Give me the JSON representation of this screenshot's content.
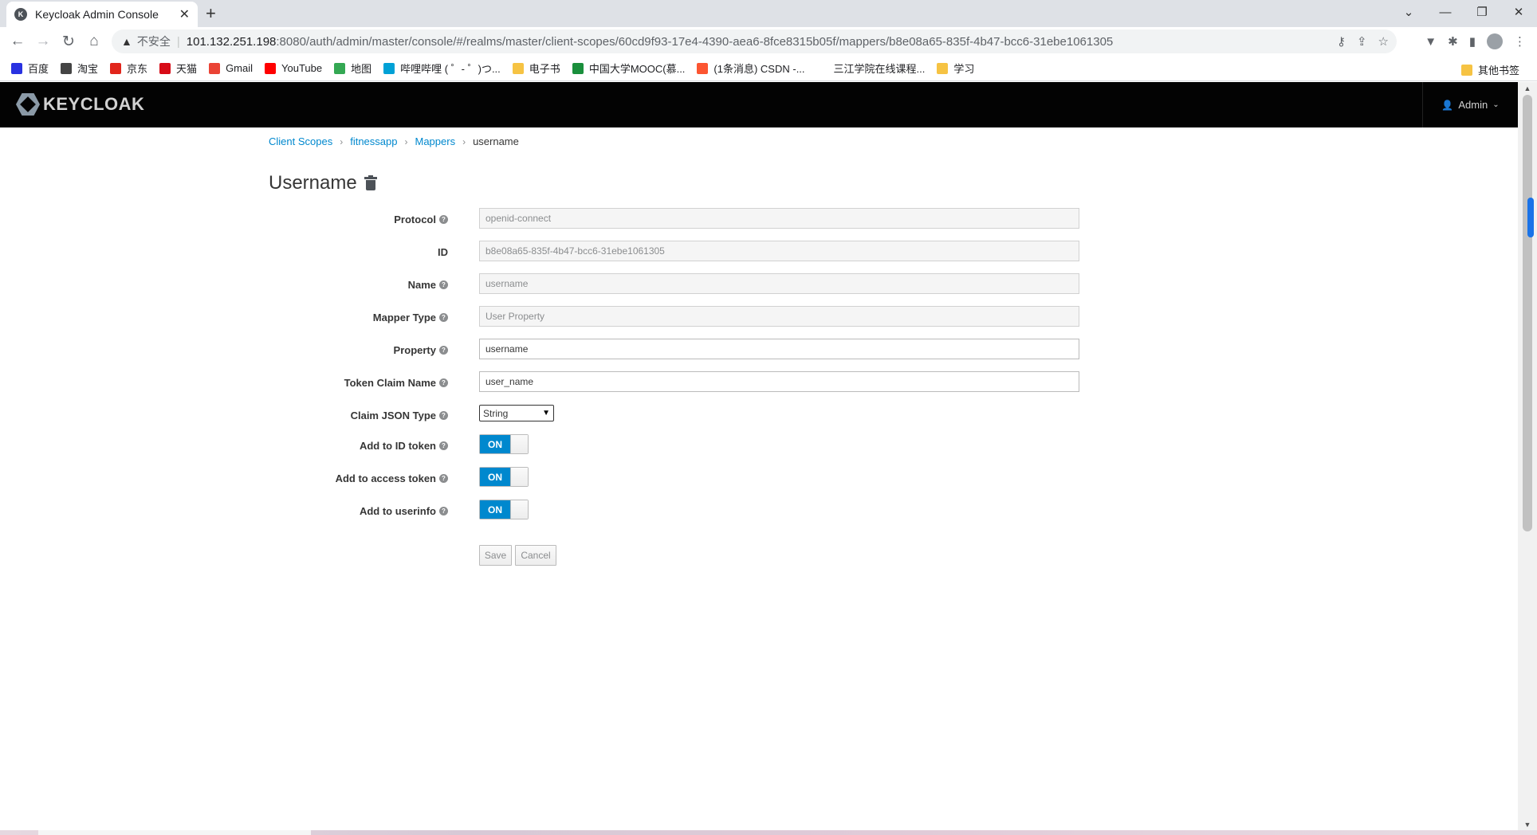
{
  "browser": {
    "tab_title": "Keycloak Admin Console",
    "tab_close": "✕",
    "new_tab": "+",
    "insecure_label": "不安全",
    "url_host": "101.132.251.198",
    "url_path": ":8080/auth/admin/master/console/#/realms/master/client-scopes/60cd9f93-17e4-4390-aea6-8fce8315b05f/mappers/b8e08a65-835f-4b47-bcc6-31ebe1061305",
    "bookmarks": [
      {
        "label": "百度",
        "color": "#2932e1"
      },
      {
        "label": "淘宝",
        "color": "#444444"
      },
      {
        "label": "京东",
        "color": "#e1251b"
      },
      {
        "label": "天猫",
        "color": "#d70b17"
      },
      {
        "label": "Gmail",
        "color": "#ea4335"
      },
      {
        "label": "YouTube",
        "color": "#ff0000"
      },
      {
        "label": "地图",
        "color": "#34a853"
      },
      {
        "label": "哔哩哔哩 ( ゜- ゜)つ...",
        "color": "#00a1d6"
      },
      {
        "label": "电子书",
        "color": "#f6c343"
      },
      {
        "label": "中国大学MOOC(慕...",
        "color": "#1a8f3c"
      },
      {
        "label": "(1条消息) CSDN -...",
        "color": "#fc5531"
      },
      {
        "label": "三江学院在线课程...",
        "color": "#ffffff"
      },
      {
        "label": "学习",
        "color": "#f6c343"
      }
    ],
    "other_bookmarks": "其他书签"
  },
  "header": {
    "logo_text": "KEYCLOAK",
    "user_label": "Admin"
  },
  "breadcrumb": {
    "items": [
      "Client Scopes",
      "fitnessapp",
      "Mappers"
    ],
    "current": "username"
  },
  "page": {
    "title": "Username"
  },
  "form": {
    "protocol": {
      "label": "Protocol",
      "value": "openid-connect"
    },
    "id": {
      "label": "ID",
      "value": "b8e08a65-835f-4b47-bcc6-31ebe1061305"
    },
    "name": {
      "label": "Name",
      "value": "username"
    },
    "mapper_type": {
      "label": "Mapper Type",
      "value": "User Property"
    },
    "property": {
      "label": "Property",
      "value": "username"
    },
    "token_claim_name": {
      "label": "Token Claim Name",
      "value": "user_name"
    },
    "claim_json_type": {
      "label": "Claim JSON Type",
      "value": "String"
    },
    "add_to_id_token": {
      "label": "Add to ID token",
      "state": "ON"
    },
    "add_to_access_token": {
      "label": "Add to access token",
      "state": "ON"
    },
    "add_to_userinfo": {
      "label": "Add to userinfo",
      "state": "ON"
    },
    "save_label": "Save",
    "cancel_label": "Cancel"
  },
  "colors": {
    "accent": "#0088ce",
    "header_bg": "#030303"
  }
}
